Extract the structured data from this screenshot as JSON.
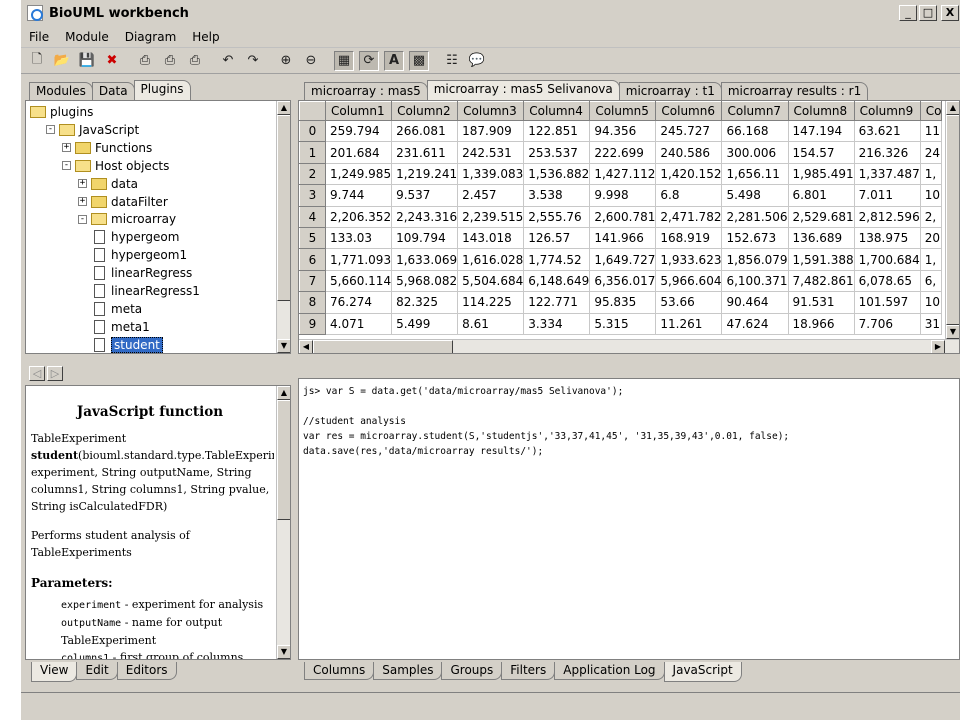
{
  "window": {
    "title": "BioUML workbench",
    "min": "_",
    "max": "□",
    "close": "X"
  },
  "menu": [
    "File",
    "Module",
    "Diagram",
    "Help"
  ],
  "left_tabs": [
    "Modules",
    "Data",
    "Plugins"
  ],
  "tree": [
    {
      "label": "plugins",
      "level": 0,
      "type": "folder-open",
      "exp": ""
    },
    {
      "label": "JavaScript",
      "level": 1,
      "type": "folder-open",
      "exp": "-"
    },
    {
      "label": "Functions",
      "level": 2,
      "type": "folder",
      "exp": "+"
    },
    {
      "label": "Host objects",
      "level": 2,
      "type": "folder-open",
      "exp": "-"
    },
    {
      "label": "data",
      "level": 3,
      "type": "folder",
      "exp": "+"
    },
    {
      "label": "dataFilter",
      "level": 3,
      "type": "folder",
      "exp": "+"
    },
    {
      "label": "microarray",
      "level": 3,
      "type": "folder-open",
      "exp": "-"
    },
    {
      "label": "hypergeom",
      "level": 4,
      "type": "doc",
      "exp": ""
    },
    {
      "label": "hypergeom1",
      "level": 4,
      "type": "doc",
      "exp": ""
    },
    {
      "label": "linearRegress",
      "level": 4,
      "type": "doc",
      "exp": ""
    },
    {
      "label": "linearRegress1",
      "level": 4,
      "type": "doc",
      "exp": ""
    },
    {
      "label": "meta",
      "level": 4,
      "type": "doc",
      "exp": ""
    },
    {
      "label": "meta1",
      "level": 4,
      "type": "doc",
      "exp": ""
    },
    {
      "label": "student",
      "level": 4,
      "type": "doc",
      "exp": "",
      "selected": true
    }
  ],
  "doc_tabs": [
    "microarray : mas5",
    "microarray : mas5 Selivanova",
    "microarray : t1",
    "microarray results : r1"
  ],
  "table": {
    "headers": [
      "Column1",
      "Column2",
      "Column3",
      "Column4",
      "Column5",
      "Column6",
      "Column7",
      "Column8",
      "Column9",
      "Co"
    ],
    "rows": [
      [
        "0",
        "259.794",
        "266.081",
        "187.909",
        "122.851",
        "94.356",
        "245.727",
        "66.168",
        "147.194",
        "63.621",
        "11"
      ],
      [
        "1",
        "201.684",
        "231.611",
        "242.531",
        "253.537",
        "222.699",
        "240.586",
        "300.006",
        "154.57",
        "216.326",
        "24"
      ],
      [
        "2",
        "1,249.985",
        "1,219.241",
        "1,339.083",
        "1,536.882",
        "1,427.112",
        "1,420.152",
        "1,656.11",
        "1,985.491",
        "1,337.487",
        "1,"
      ],
      [
        "3",
        "9.744",
        "9.537",
        "2.457",
        "3.538",
        "9.998",
        "6.8",
        "5.498",
        "6.801",
        "7.011",
        "10"
      ],
      [
        "4",
        "2,206.352",
        "2,243.316",
        "2,239.515",
        "2,555.76",
        "2,600.781",
        "2,471.782",
        "2,281.506",
        "2,529.681",
        "2,812.596",
        "2,"
      ],
      [
        "5",
        "133.03",
        "109.794",
        "143.018",
        "126.57",
        "141.966",
        "168.919",
        "152.673",
        "136.689",
        "138.975",
        "20"
      ],
      [
        "6",
        "1,771.093",
        "1,633.069",
        "1,616.028",
        "1,774.52",
        "1,649.727",
        "1,933.623",
        "1,856.079",
        "1,591.388",
        "1,700.684",
        "1,"
      ],
      [
        "7",
        "5,660.114",
        "5,968.082",
        "5,504.684",
        "6,148.649",
        "6,356.017",
        "5,966.604",
        "6,100.371",
        "7,482.861",
        "6,078.65",
        "6,"
      ],
      [
        "8",
        "76.274",
        "82.325",
        "114.225",
        "122.771",
        "95.835",
        "53.66",
        "90.464",
        "91.531",
        "101.597",
        "10"
      ],
      [
        "9",
        "4.071",
        "5.499",
        "8.61",
        "3.334",
        "5.315",
        "11.261",
        "47.624",
        "18.966",
        "7.706",
        "31"
      ]
    ]
  },
  "doc": {
    "title": "JavaScript function",
    "return_type": "TableExperiment",
    "fn_name": "student",
    "signature": "(biouml.standard.type.TableExperiment experiment, String outputName, String columns1, String columns1, String pvalue, String isCalculatedFDR)",
    "description": "Performs student analysis of TableExperiments",
    "params_title": "Parameters:",
    "p1_name": "experiment",
    "p1_desc": " - experiment for analysis",
    "p2_name": "outputName",
    "p2_desc": " - name for output TableExperiment",
    "p3_name": "columns1",
    "p3_desc": " - first group of columns"
  },
  "left_bottom_tabs": [
    "View",
    "Edit",
    "Editors"
  ],
  "console": {
    "line1": "js> var S = data.get('data/microarray/mas5 Selivanova');",
    "line2": "",
    "line3": "//student analysis",
    "line4": "var res = microarray.student(S,'studentjs','33,37,41,45', '31,35,39,43',0.01, false);",
    "line5": "data.save(res,'data/microarray results/');"
  },
  "bottom_tabs": [
    "Columns",
    "Samples",
    "Groups",
    "Filters",
    "Application Log",
    "JavaScript"
  ],
  "icons": [
    "new-icon",
    "open-icon",
    "save-icon",
    "close-file-icon",
    "print-icon",
    "print-preview-icon",
    "page-setup-icon",
    "undo-icon",
    "redo-icon",
    "zoom-in-icon",
    "zoom-out-icon",
    "layout-icon",
    "refresh-icon",
    "text-icon",
    "grid-icon",
    "properties-icon",
    "help-icon"
  ]
}
